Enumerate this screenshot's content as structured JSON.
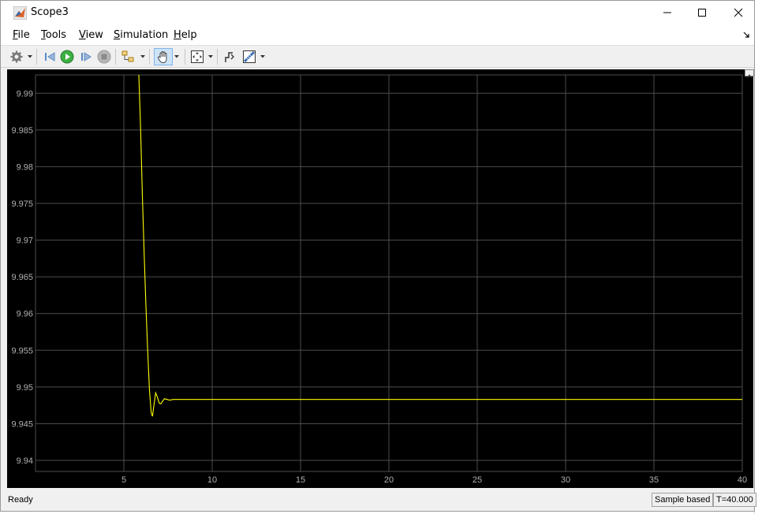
{
  "window": {
    "title": "Scope3"
  },
  "menu": [
    {
      "label": "File",
      "mnemonic": "F",
      "rest": "ile"
    },
    {
      "label": "Tools",
      "mnemonic": "T",
      "rest": "ools"
    },
    {
      "label": "View",
      "mnemonic": "V",
      "rest": "iew"
    },
    {
      "label": "Simulation",
      "mnemonic": "S",
      "rest": "imulation"
    },
    {
      "label": "Help",
      "mnemonic": "H",
      "rest": "elp"
    }
  ],
  "toolbar": {
    "icons": [
      "settings-gear-icon",
      "step-back-icon",
      "run-icon",
      "step-forward-icon",
      "stop-icon",
      "highlight-block-icon",
      "pan-hand-icon",
      "zoom-fit-icon",
      "triggers-icon",
      "measurements-icon"
    ],
    "active": "pan-hand-icon"
  },
  "status": {
    "left": "Ready",
    "mode": "Sample based",
    "time": "T=40.000"
  },
  "colors": {
    "plot_background": "#000000",
    "grid": "#4d4d4d",
    "trace": "#ffff00",
    "tick_text": "#b0b0b0"
  },
  "chart_data": {
    "type": "line",
    "title": "",
    "xlabel": "",
    "ylabel": "",
    "xlim": [
      0,
      40
    ],
    "ylim": [
      9.9385,
      9.9925
    ],
    "xticks": [
      "5",
      "10",
      "15",
      "20",
      "25",
      "30",
      "35",
      "40"
    ],
    "xtick_values": [
      5,
      10,
      15,
      20,
      25,
      30,
      35,
      40
    ],
    "yticks": [
      "9.94",
      "9.945",
      "9.95",
      "9.955",
      "9.96",
      "9.965",
      "9.97",
      "9.975",
      "9.98",
      "9.985",
      "9.99"
    ],
    "ytick_values": [
      9.94,
      9.945,
      9.95,
      9.955,
      9.96,
      9.965,
      9.97,
      9.975,
      9.98,
      9.985,
      9.99
    ],
    "grid": true,
    "series": [
      {
        "color": "#ffff00",
        "x": [
          5.85,
          5.95,
          6.05,
          6.15,
          6.25,
          6.35,
          6.45,
          6.55,
          6.62,
          6.7,
          6.8,
          6.9,
          7.0,
          7.1,
          7.2,
          7.3,
          7.45,
          7.6,
          7.8,
          8.5,
          40
        ],
        "y": [
          9.9925,
          9.985,
          9.976,
          9.968,
          9.961,
          9.955,
          9.9495,
          9.9465,
          9.946,
          9.9475,
          9.9492,
          9.9486,
          9.9478,
          9.9477,
          9.9481,
          9.9484,
          9.9483,
          9.9482,
          9.9483,
          9.9483,
          9.9483
        ]
      }
    ]
  }
}
